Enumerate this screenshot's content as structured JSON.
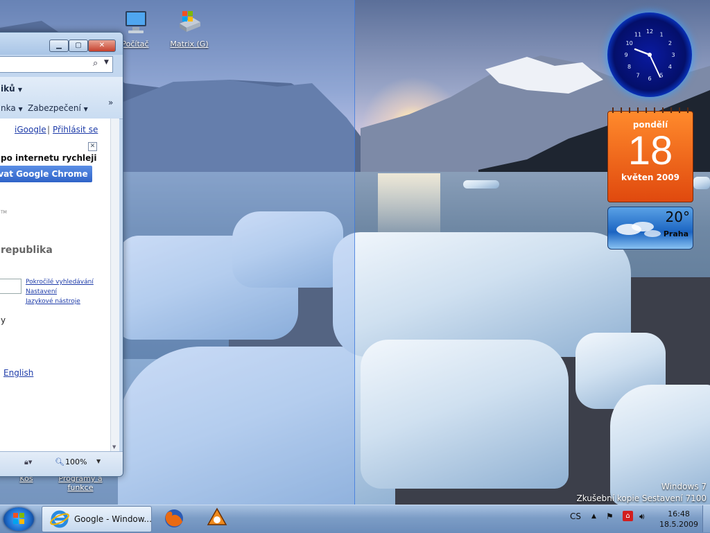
{
  "desktop": {
    "icons": [
      {
        "label": "Počítač",
        "icon": "computer-icon"
      },
      {
        "label": "Matrix (G)",
        "icon": "network-drive-icon"
      },
      {
        "label": "Koš",
        "icon": "recycle-bin-icon"
      },
      {
        "label": "Programy a funkce",
        "icon": "programs-icon"
      }
    ],
    "watermark_line1": "Windows 7",
    "watermark_line2": "Zkušební kopie Sestavení 7100"
  },
  "browser": {
    "toolbar": {
      "favorites_partial": "iků",
      "page_partial": "nka",
      "security_label": "Zabezpečení",
      "more": "»"
    },
    "page": {
      "igoogle_link": "iGoogle",
      "separator": "|",
      "signin_link": "Přihlásit se",
      "promo_text": "po internetu rychleji",
      "promo_button": "vat Google Chrome",
      "tm": "TM",
      "region": "republika",
      "advanced_search": "Pokročilé vyhledávání",
      "settings": "Nastavení",
      "language_tools": "Jazykové nástroje",
      "partial_y": "y",
      "english_link": "English"
    },
    "status": {
      "zoom": "100%"
    }
  },
  "gadgets": {
    "calendar": {
      "weekday": "pondělí",
      "day": "18",
      "month_year": "květen 2009"
    },
    "weather": {
      "temperature": "20°",
      "city": "Praha"
    },
    "clock": {
      "numbers": [
        "12",
        "1",
        "2",
        "3",
        "4",
        "5",
        "6",
        "7",
        "8",
        "9",
        "10",
        "11"
      ]
    }
  },
  "taskbar": {
    "active_task": "Google - Window...",
    "language": "CS",
    "time": "16:48",
    "date": "18.5.2009",
    "colors": {
      "accent": "#1e6fd0",
      "calendar": "#e0490e"
    }
  }
}
